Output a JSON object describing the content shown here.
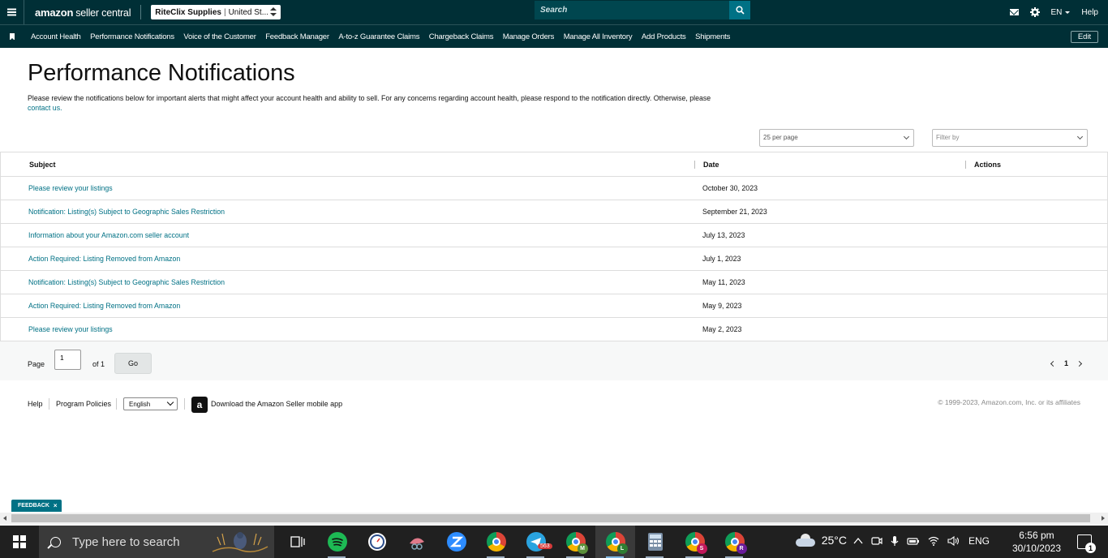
{
  "topbar": {
    "logo_brand": "amazon",
    "logo_rest": "seller central",
    "store_name": "RiteClix Supplies",
    "store_region": "United St...",
    "search_placeholder": "Search",
    "lang": "EN",
    "help": "Help"
  },
  "nav": {
    "items": [
      "Account Health",
      "Performance Notifications",
      "Voice of the Customer",
      "Feedback Manager",
      "A-to-z Guarantee Claims",
      "Chargeback Claims",
      "Manage Orders",
      "Manage All Inventory",
      "Add Products",
      "Shipments"
    ],
    "edit": "Edit"
  },
  "page": {
    "title": "Performance Notifications",
    "description": "Please review the notifications below for important alerts that might affect your account health and ability to sell. For any concerns regarding account health, please respond to the notification directly. Otherwise, please ",
    "contact_link": "contact us.",
    "per_page": "25 per page",
    "filter_placeholder": "Filter by"
  },
  "table": {
    "headers": {
      "subject": "Subject",
      "date": "Date",
      "actions": "Actions"
    },
    "rows": [
      {
        "subject": "Please review your listings",
        "date": "October 30, 2023"
      },
      {
        "subject": "Notification: Listing(s) Subject to Geographic Sales Restriction",
        "date": "September 21, 2023"
      },
      {
        "subject": "Information about your Amazon.com seller account",
        "date": "July 13, 2023"
      },
      {
        "subject": "Action Required: Listing Removed from Amazon",
        "date": "July 1, 2023"
      },
      {
        "subject": "Notification: Listing(s) Subject to Geographic Sales Restriction",
        "date": "May 11, 2023"
      },
      {
        "subject": "Action Required: Listing Removed from Amazon",
        "date": "May 9, 2023"
      },
      {
        "subject": "Please review your listings",
        "date": "May 2, 2023"
      }
    ]
  },
  "pager": {
    "page_label": "Page",
    "page_value": "1",
    "of_label": "of 1",
    "go": "Go",
    "current": "1"
  },
  "footer": {
    "help": "Help",
    "policies": "Program Policies",
    "language": "English",
    "app_icon_letter": "a",
    "app_link": "Download the Amazon Seller mobile app",
    "copyright": "© 1999-2023, Amazon.com, Inc. or its affiliates"
  },
  "feedback": {
    "label": "FEEDBACK",
    "close": "×"
  },
  "taskbar": {
    "search_placeholder": "Type here to search",
    "telegram_badge": "563",
    "chrome_profiles": [
      "M",
      "L",
      "S",
      "R"
    ],
    "temperature": "25°C",
    "lang": "ENG",
    "time": "6:56 pm",
    "date": "30/10/2023",
    "notification_count": "1",
    "colors": {
      "profile_m": "#5a8f3a",
      "profile_l": "#2e7d32",
      "profile_s": "#c2185b",
      "profile_r": "#6a1b9a"
    }
  },
  "colors": {
    "header_bg": "#002f36",
    "link": "#007185",
    "search_btn": "#007185"
  }
}
